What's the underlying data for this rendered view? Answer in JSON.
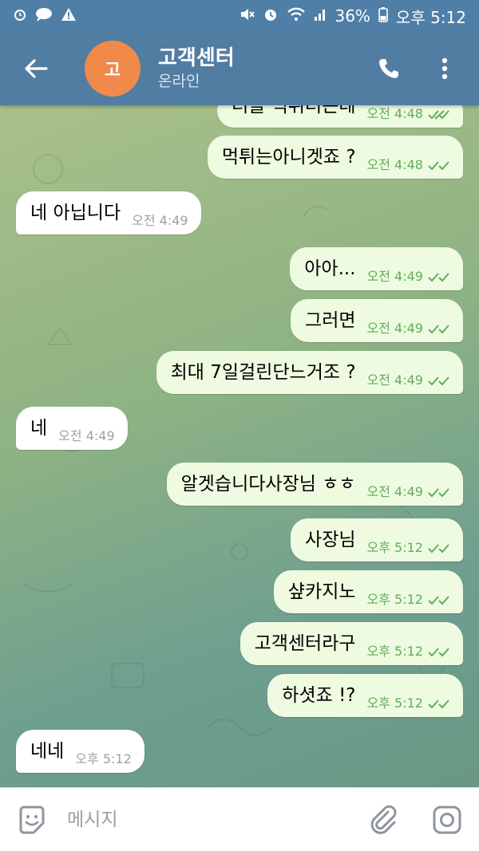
{
  "status_bar": {
    "battery": "36%",
    "time": "오후 5:12",
    "left_icons": [
      "alarm-icon",
      "chat-bubble-icon",
      "warning-icon"
    ],
    "right_icons": [
      "mute-icon",
      "alarm-icon",
      "wifi-icon",
      "signal-icon",
      "battery-icon"
    ]
  },
  "header": {
    "avatar_initial": "고",
    "title": "고객센터",
    "status": "온라인",
    "avatar_color": "#ef8a4b",
    "bar_color": "#517da2"
  },
  "messages": [
    {
      "direction": "out",
      "text": "더블 먹튀더는데",
      "time": "오전 4:48",
      "read": true
    },
    {
      "direction": "out",
      "text": "먹튀는아니겟죠 ?",
      "time": "오전 4:48",
      "read": true
    },
    {
      "direction": "in",
      "text": "네 아닙니다",
      "time": "오전 4:49"
    },
    {
      "direction": "out",
      "text": "아아...",
      "time": "오전 4:49",
      "read": true
    },
    {
      "direction": "out",
      "text": "그러면",
      "time": "오전 4:49",
      "read": true
    },
    {
      "direction": "out",
      "text": "최대 7일걸린단느거조 ?",
      "time": "오전 4:49",
      "read": true
    },
    {
      "direction": "in",
      "text": "네",
      "time": "오전 4:49"
    },
    {
      "direction": "out",
      "text": "알겟습니다사장님 ㅎㅎ",
      "time": "오전 4:49",
      "read": true
    },
    {
      "direction": "out",
      "text": "사장님",
      "time": "오후 5:12",
      "read": true
    },
    {
      "direction": "out",
      "text": "샾카지노",
      "time": "오후 5:12",
      "read": true
    },
    {
      "direction": "out",
      "text": "고객센터라구",
      "time": "오후 5:12",
      "read": true
    },
    {
      "direction": "out",
      "text": "하셧죠 !?",
      "time": "오후 5:12",
      "read": true
    },
    {
      "direction": "in",
      "text": "네네",
      "time": "오후 5:12"
    }
  ],
  "input": {
    "placeholder": "메시지",
    "value": ""
  },
  "colors": {
    "outgoing_bubble": "#eefbe0",
    "incoming_bubble": "#ffffff",
    "read_ticks": "#5fae5c"
  }
}
